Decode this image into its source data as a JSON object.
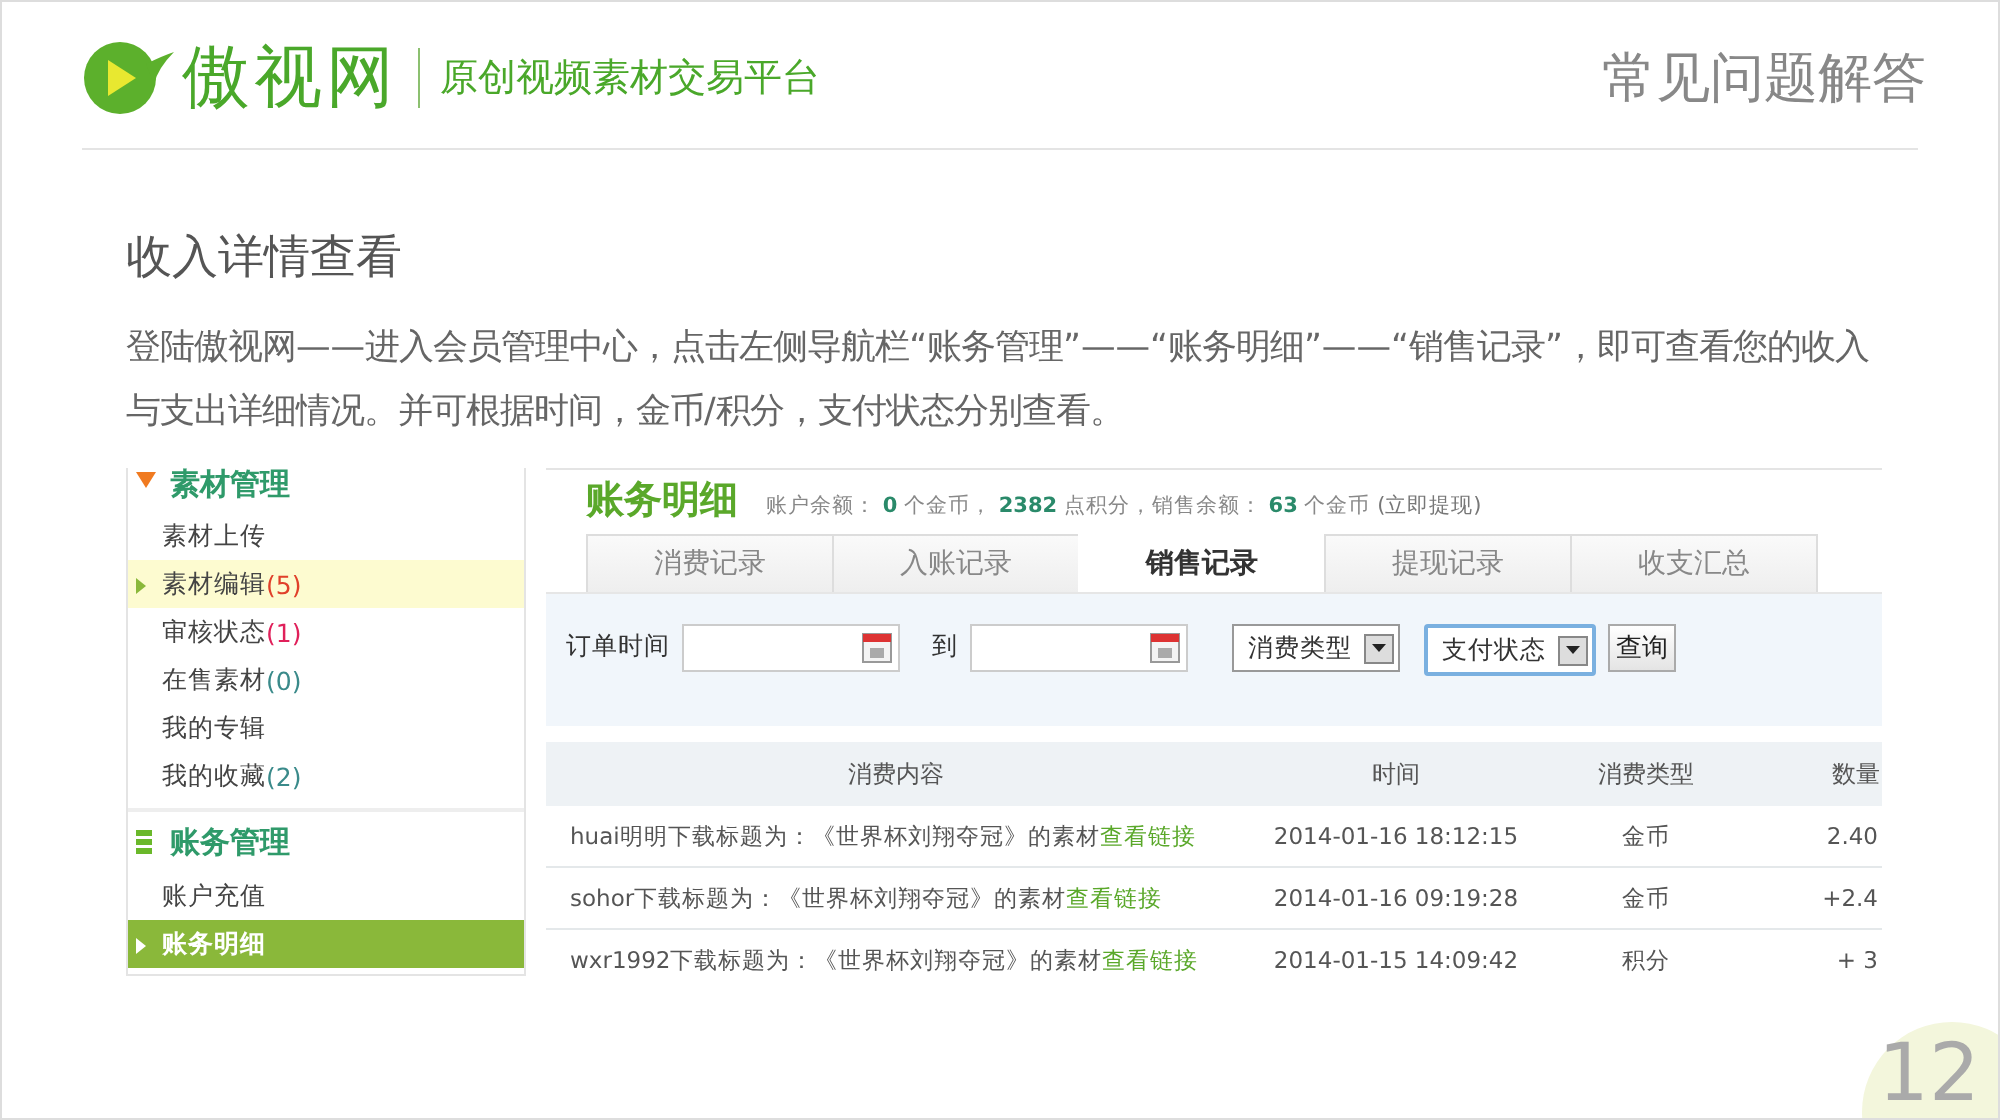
{
  "header": {
    "brand": "傲视网",
    "tagline": "原创视频素材交易平台",
    "title": "常见问题解答"
  },
  "section": {
    "title": "收入详情查看",
    "paragraph": "登陆傲视网——进入会员管理中心，点击左侧导航栏“账务管理”——“账务明细”——“销售记录”，即可查看您的收入与支出详细情况。并可根据时间，金币/积分，支付状态分别查看。"
  },
  "sidebar": {
    "groups": [
      {
        "title": "素材管理",
        "kind": "media",
        "items": [
          {
            "label": "素材上传",
            "selected": false,
            "hovered": false
          },
          {
            "label": "素材编辑",
            "count": "(5)",
            "color": "#e0402a",
            "selected": false,
            "hovered": true
          },
          {
            "label": "审核状态",
            "count": "(1)",
            "color": "#e0205a",
            "selected": false,
            "hovered": false
          },
          {
            "label": "在售素材",
            "count": "(0)",
            "color": "#3a8a8a",
            "selected": false,
            "hovered": false
          },
          {
            "label": "我的专辑",
            "selected": false,
            "hovered": false
          },
          {
            "label": "我的收藏",
            "count": " (2)",
            "color": "#3a8a8a",
            "selected": false,
            "hovered": false
          }
        ]
      },
      {
        "title": "账务管理",
        "kind": "finance",
        "items": [
          {
            "label": "账户充值",
            "selected": false,
            "hovered": false
          },
          {
            "label": "账务明细",
            "selected": true,
            "hovered": false
          }
        ]
      }
    ]
  },
  "main": {
    "heading": "账务明细",
    "summary": "账户余额： **0** 个金币， **2382** 点积分，销售余额： **63** 个金币",
    "withdraw_link": "(立即提现)",
    "tabs": [
      {
        "label": "消费记录",
        "selected": false
      },
      {
        "label": "入账记录",
        "selected": false
      },
      {
        "label": "销售记录",
        "selected": true
      },
      {
        "label": "提现记录",
        "selected": false
      },
      {
        "label": "收支汇总",
        "selected": false
      }
    ],
    "filter": {
      "time_label": "订单时间",
      "to_label": "到",
      "type_select": "消费类型",
      "status_select": "支付状态",
      "status_focused": true,
      "query_button": "查询"
    },
    "table": {
      "columns": [
        "消费内容",
        "时间",
        "消费类型",
        "数量"
      ],
      "rows": [
        {
          "content": "huai明明下载标题为：《世界杯刘翔夺冠》的素材",
          "link": "查看链接",
          "time": "2014-01-16 18:12:15",
          "type": "金币",
          "amount": "2.40"
        },
        {
          "content": "sohor下载标题为：《世界杯刘翔夺冠》的素材",
          "link": "查看链接",
          "time": "2014-01-16 09:19:28",
          "type": "金币",
          "amount": "+2.4"
        },
        {
          "content": "wxr1992下载标题为：《世界杯刘翔夺冠》的素材",
          "link": "查看链接",
          "time": "2014-01-15 14:09:42",
          "type": "积分",
          "amount": "+ 3"
        }
      ]
    }
  },
  "page_number": "12"
}
